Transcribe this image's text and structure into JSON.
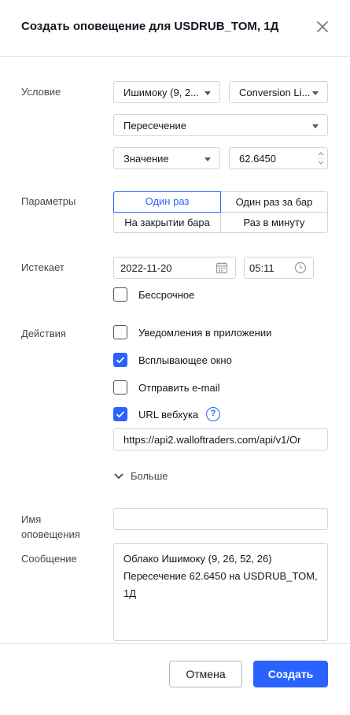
{
  "dialog": {
    "title": "Создать оповещение для USDRUB_TOM, 1Д",
    "close_icon": "close-icon"
  },
  "condition": {
    "label": "Условие",
    "indicator": "Ишимоку (9, 2...",
    "line": "Conversion Li...",
    "operator": "Пересечение",
    "value_type": "Значение",
    "value": "62.6450"
  },
  "params": {
    "label": "Параметры",
    "options": [
      "Один раз",
      "Один раз за бар",
      "На закрытии бара",
      "Раз в минуту"
    ],
    "selected": "Один раз"
  },
  "expiry": {
    "label": "Истекает",
    "date": "2022-11-20",
    "time": "05:11",
    "open_ended_label": "Бессрочное",
    "open_ended": false
  },
  "actions": {
    "label": "Действия",
    "items": [
      {
        "label": "Уведомления в приложении",
        "checked": false
      },
      {
        "label": "Всплывающее окно",
        "checked": true
      },
      {
        "label": "Отправить e-mail",
        "checked": false
      },
      {
        "label": "URL вебхука",
        "checked": true
      }
    ],
    "help": "?",
    "webhook_url": "https://api2.walloftraders.com/api/v1/Or",
    "more_label": "Больше"
  },
  "name": {
    "label_line1": "Имя",
    "label_line2": "оповещения",
    "value": ""
  },
  "message": {
    "label": "Сообщение",
    "line1": "Облако Ишимоку (9, 26, 52, 26)",
    "line2": "Пересечение 62.6450 на USDRUB_TOM,",
    "line3": "1Д"
  },
  "footer": {
    "cancel_label": "Отмена",
    "create_label": "Создать"
  },
  "colors": {
    "accent": "#2962ff",
    "border": "#d1d4dc",
    "text": "#131722"
  }
}
